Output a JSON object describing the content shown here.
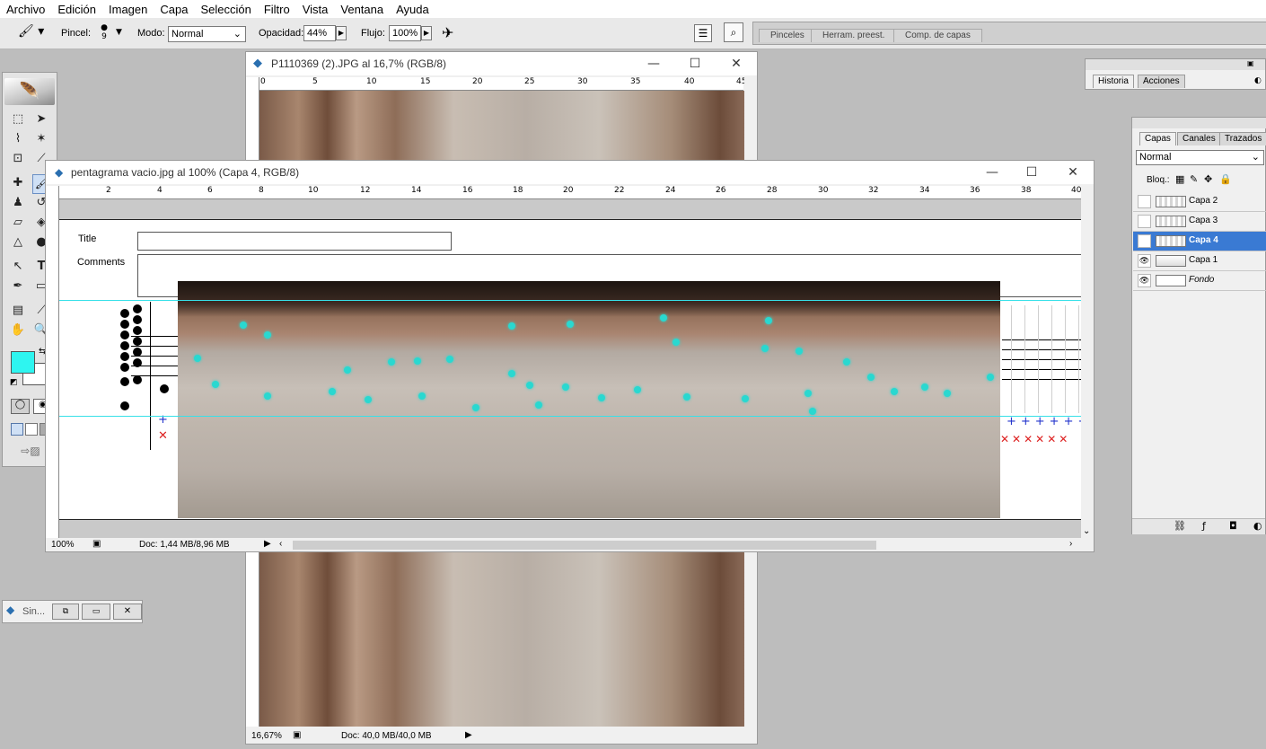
{
  "menu": [
    "Archivo",
    "Edición",
    "Imagen",
    "Capa",
    "Selección",
    "Filtro",
    "Vista",
    "Ventana",
    "Ayuda"
  ],
  "options": {
    "brush_label": "Pincel:",
    "brush_size": "9",
    "mode_label": "Modo:",
    "mode_value": "Normal",
    "opacity_label": "Opacidad:",
    "opacity_value": "44%",
    "flow_label": "Flujo:",
    "flow_value": "100%",
    "well_tabs": [
      "Pinceles",
      "Herram. preest.",
      "Comp. de capas"
    ]
  },
  "bg_window": {
    "title": "P1110369 (2).JPG al 16,7% (RGB/8)",
    "ruler": [
      "0",
      "5",
      "10",
      "15",
      "20",
      "25",
      "30",
      "35",
      "40",
      "45"
    ],
    "zoom": "16,67%",
    "doc": "Doc: 40,0 MB/40,0 MB"
  },
  "fg_window": {
    "title": "pentagrama vacio.jpg al 100% (Capa 4, RGB/8)",
    "ruler": [
      "2",
      "4",
      "6",
      "8",
      "10",
      "12",
      "14",
      "16",
      "18",
      "20",
      "22",
      "24",
      "26",
      "28",
      "30",
      "32",
      "34",
      "36",
      "38",
      "40"
    ],
    "title_field_label": "Title",
    "comments_label": "Comments",
    "zoom": "100%",
    "doc": "Doc: 1,44 MB/8,96 MB"
  },
  "mini_window": {
    "title": "Sin..."
  },
  "history_panel": {
    "tabs": [
      "Historia",
      "Acciones"
    ]
  },
  "layers_panel": {
    "tabs": [
      "Capas",
      "Canales",
      "Trazados"
    ],
    "blend_mode": "Normal",
    "lock_label": "Bloq.:",
    "layers": [
      {
        "name": "Capa 2",
        "visible": false,
        "selected": false
      },
      {
        "name": "Capa 3",
        "visible": false,
        "selected": false
      },
      {
        "name": "Capa 4",
        "visible": true,
        "selected": true
      },
      {
        "name": "Capa 1",
        "visible": true,
        "selected": false
      },
      {
        "name": "Fondo",
        "visible": true,
        "selected": false
      }
    ]
  },
  "colors": {
    "foreground": "#2ef5f0",
    "background": "#ffffff",
    "selection": "#3a7ad3"
  }
}
